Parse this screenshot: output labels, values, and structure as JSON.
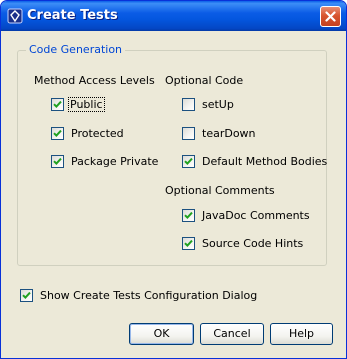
{
  "window": {
    "title": "Create Tests"
  },
  "code_generation": {
    "legend": "Code Generation",
    "method_access_levels": {
      "heading": "Method Access Levels",
      "options": [
        {
          "label": "Public",
          "checked": true
        },
        {
          "label": "Protected",
          "checked": true
        },
        {
          "label": "Package Private",
          "checked": true
        }
      ]
    },
    "optional_code": {
      "heading": "Optional Code",
      "options": [
        {
          "label": "setUp",
          "checked": false
        },
        {
          "label": "tearDown",
          "checked": false
        },
        {
          "label": "Default Method Bodies",
          "checked": true
        }
      ]
    },
    "optional_comments": {
      "heading": "Optional Comments",
      "options": [
        {
          "label": "JavaDoc Comments",
          "checked": true
        },
        {
          "label": "Source Code Hints",
          "checked": true
        }
      ]
    }
  },
  "show_config_dialog": {
    "label": "Show Create Tests Configuration Dialog",
    "checked": true
  },
  "buttons": {
    "ok": "OK",
    "cancel": "Cancel",
    "help": "Help"
  },
  "colors": {
    "titlebar": "#0b5ce6",
    "legend_text": "#0046d5",
    "check_mark": "#21a121",
    "dialog_bg": "#ece9d8"
  }
}
